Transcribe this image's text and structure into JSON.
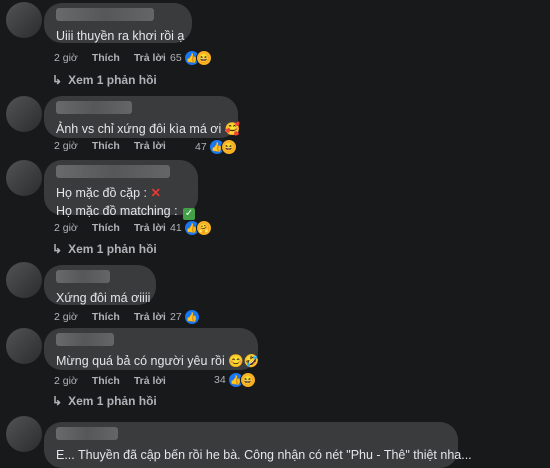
{
  "labels": {
    "like": "Thích",
    "reply": "Trả lời",
    "view_reply": "Xem 1 phản hồi"
  },
  "icons": {
    "like": "thumbs-up-icon",
    "haha": "laughing-face-icon",
    "care": "hug-face-icon",
    "reply_arrow": "reply-arrow-icon"
  },
  "colors": {
    "background": "#18191a",
    "bubble": "#3a3b3c",
    "text": "#e4e6eb",
    "muted": "#b0b3b8",
    "like_blue": "#1877f2"
  },
  "comments": [
    {
      "text": "Uiii thuyền ra khơi rồi ạ",
      "time": "2 giờ",
      "reactions": "65",
      "reply_link": true
    },
    {
      "text": "Ảnh vs chỉ xứng đôi kìa má ơi 🥰",
      "time": "2 giờ",
      "reactions": "47",
      "reply_link": false
    },
    {
      "line1": "Họ mặc đồ cặp : ",
      "mark1": "✕",
      "line2": "Họ mặc đồ matching : ",
      "mark2": "✓",
      "time": "2 giờ",
      "reactions": "41",
      "reply_link": true
    },
    {
      "text": "Xứng đôi má ơiiii",
      "time": "2 giờ",
      "reactions": "27",
      "reply_link": false
    },
    {
      "text": "Mừng quá bả có người yêu rồi 😊🤣",
      "time": "2 giờ",
      "reactions": "34",
      "reply_link": true
    },
    {
      "text": "E... Thuyền đã cập bến rồi he bà. Công nhận có nét \"Phu - Thê\" thiệt nha..."
    }
  ]
}
